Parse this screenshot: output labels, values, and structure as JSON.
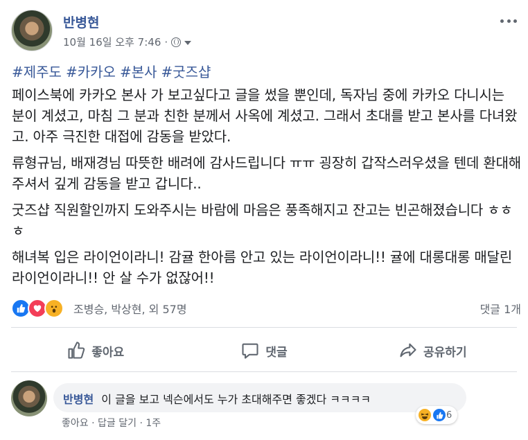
{
  "post": {
    "author": "반병현",
    "timestamp": "10월 16일 오후 7:46",
    "meta_separator": "·",
    "hashtags": [
      "#제주도",
      "#카카오",
      "#본사",
      "#굿즈샵"
    ],
    "paragraphs": [
      "페이스북에 카카오 본사 가 보고싶다고 글을 썼을 뿐인데, 독자님 중에 카카오 다니시는 분이 계셨고, 마침 그 분과 친한 분께서 사옥에 계셨고. 그래서 초대를 받고 본사를 다녀왔고. 아주 극진한 대접에 감동을 받았다.",
      "류형규님, 배재경님 따뜻한 배려에 감사드립니다 ㅠㅠ 굉장히 갑작스러우셨을 텐데 환대해 주셔서 깊게 감동을 받고 갑니다..",
      "굿즈샵 직원할인까지 도와주시는 바람에 마음은 풍족해지고 잔고는 빈곤해졌습니다 ㅎㅎㅎ",
      "해녀복 입은 라이언이라니! 감귤 한아름 안고 있는 라이언이라니!! 귤에 대롱대롱 매달린 라이언이라니!! 안 살 수가 없잖어!!"
    ]
  },
  "reactions": {
    "icons": [
      "like-icon",
      "love-icon",
      "wow-icon"
    ],
    "summary": "조병승, 박상현, 외 57명",
    "comment_count": "댓글 1개"
  },
  "actions": {
    "like_label": "좋아요",
    "comment_label": "댓글",
    "share_label": "공유하기"
  },
  "comment": {
    "author": "반병현",
    "text": "이 글을 보고 넥슨에서도 누가 초대해주면 좋겠다 ㅋㅋㅋㅋ",
    "like_label": "좋아요",
    "sep1": "·",
    "reply_label": "답글 달기",
    "sep2": "·",
    "time": "1주",
    "reaction_count": "6"
  },
  "colors": {
    "link": "#385898",
    "like": "#1877f2",
    "love": "#f33e58",
    "wow": "#f7b125"
  }
}
